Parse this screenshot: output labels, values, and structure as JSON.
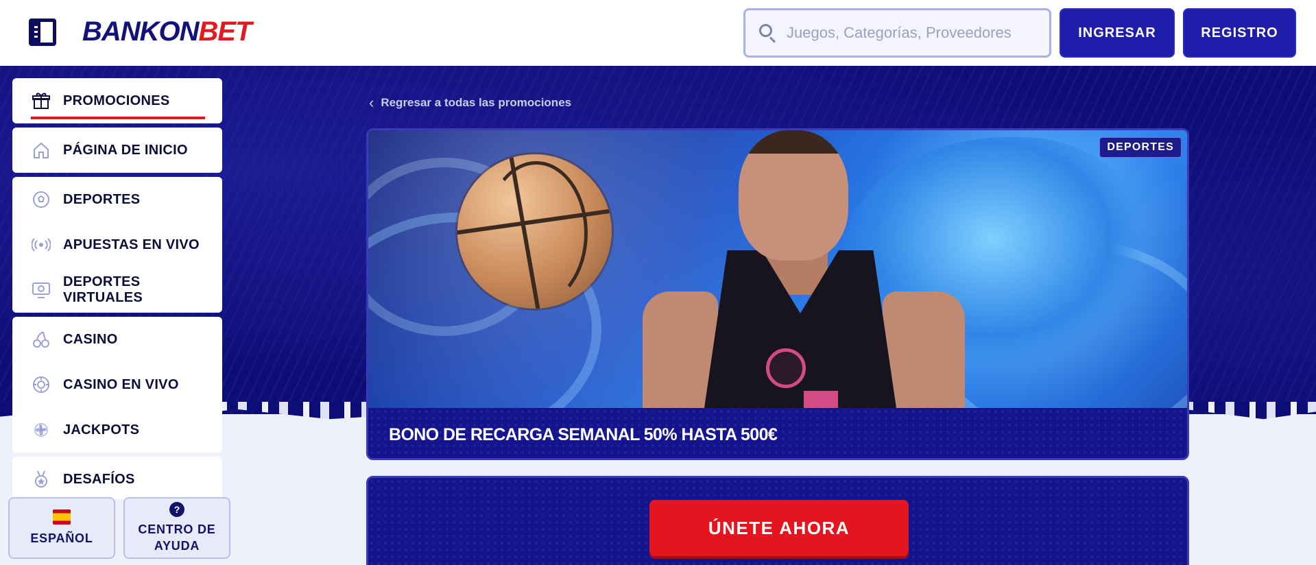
{
  "header": {
    "logo_part1": "BANKON",
    "logo_part2": "BET",
    "search_placeholder": "Juegos, Categorías, Proveedores",
    "login_label": "INGRESAR",
    "register_label": "REGISTRO"
  },
  "sidebar": {
    "group1": [
      {
        "label": "PROMOCIONES",
        "icon": "gift-icon",
        "active": true
      }
    ],
    "group2": [
      {
        "label": "PÁGINA DE INICIO",
        "icon": "home-icon"
      }
    ],
    "group3": [
      {
        "label": "DEPORTES",
        "icon": "soccer-ball-icon"
      },
      {
        "label": "APUESTAS EN VIVO",
        "icon": "live-broadcast-icon"
      },
      {
        "label": "DEPORTES VIRTUALES",
        "icon": "virtual-monitor-icon"
      }
    ],
    "group4": [
      {
        "label": "CASINO",
        "icon": "cherries-icon"
      },
      {
        "label": "CASINO EN VIVO",
        "icon": "poker-chip-icon"
      },
      {
        "label": "JACKPOTS",
        "icon": "clover-icon"
      }
    ],
    "group5": [
      {
        "label": "DESAFÍOS",
        "icon": "medal-icon"
      }
    ],
    "language_label": "ESPAÑOL",
    "help_label": "CENTRO DE AYUDA"
  },
  "main": {
    "back_link": "Regresar a todas las promociones",
    "promo": {
      "tag": "DEPORTES",
      "title": "BONO DE RECARGA SEMANAL 50% HASTA 500€"
    },
    "cta_label": "ÚNETE AHORA"
  },
  "colors": {
    "brand_blue": "#12127a",
    "brand_red": "#e11b22",
    "background_dark": "#0d0d78"
  }
}
